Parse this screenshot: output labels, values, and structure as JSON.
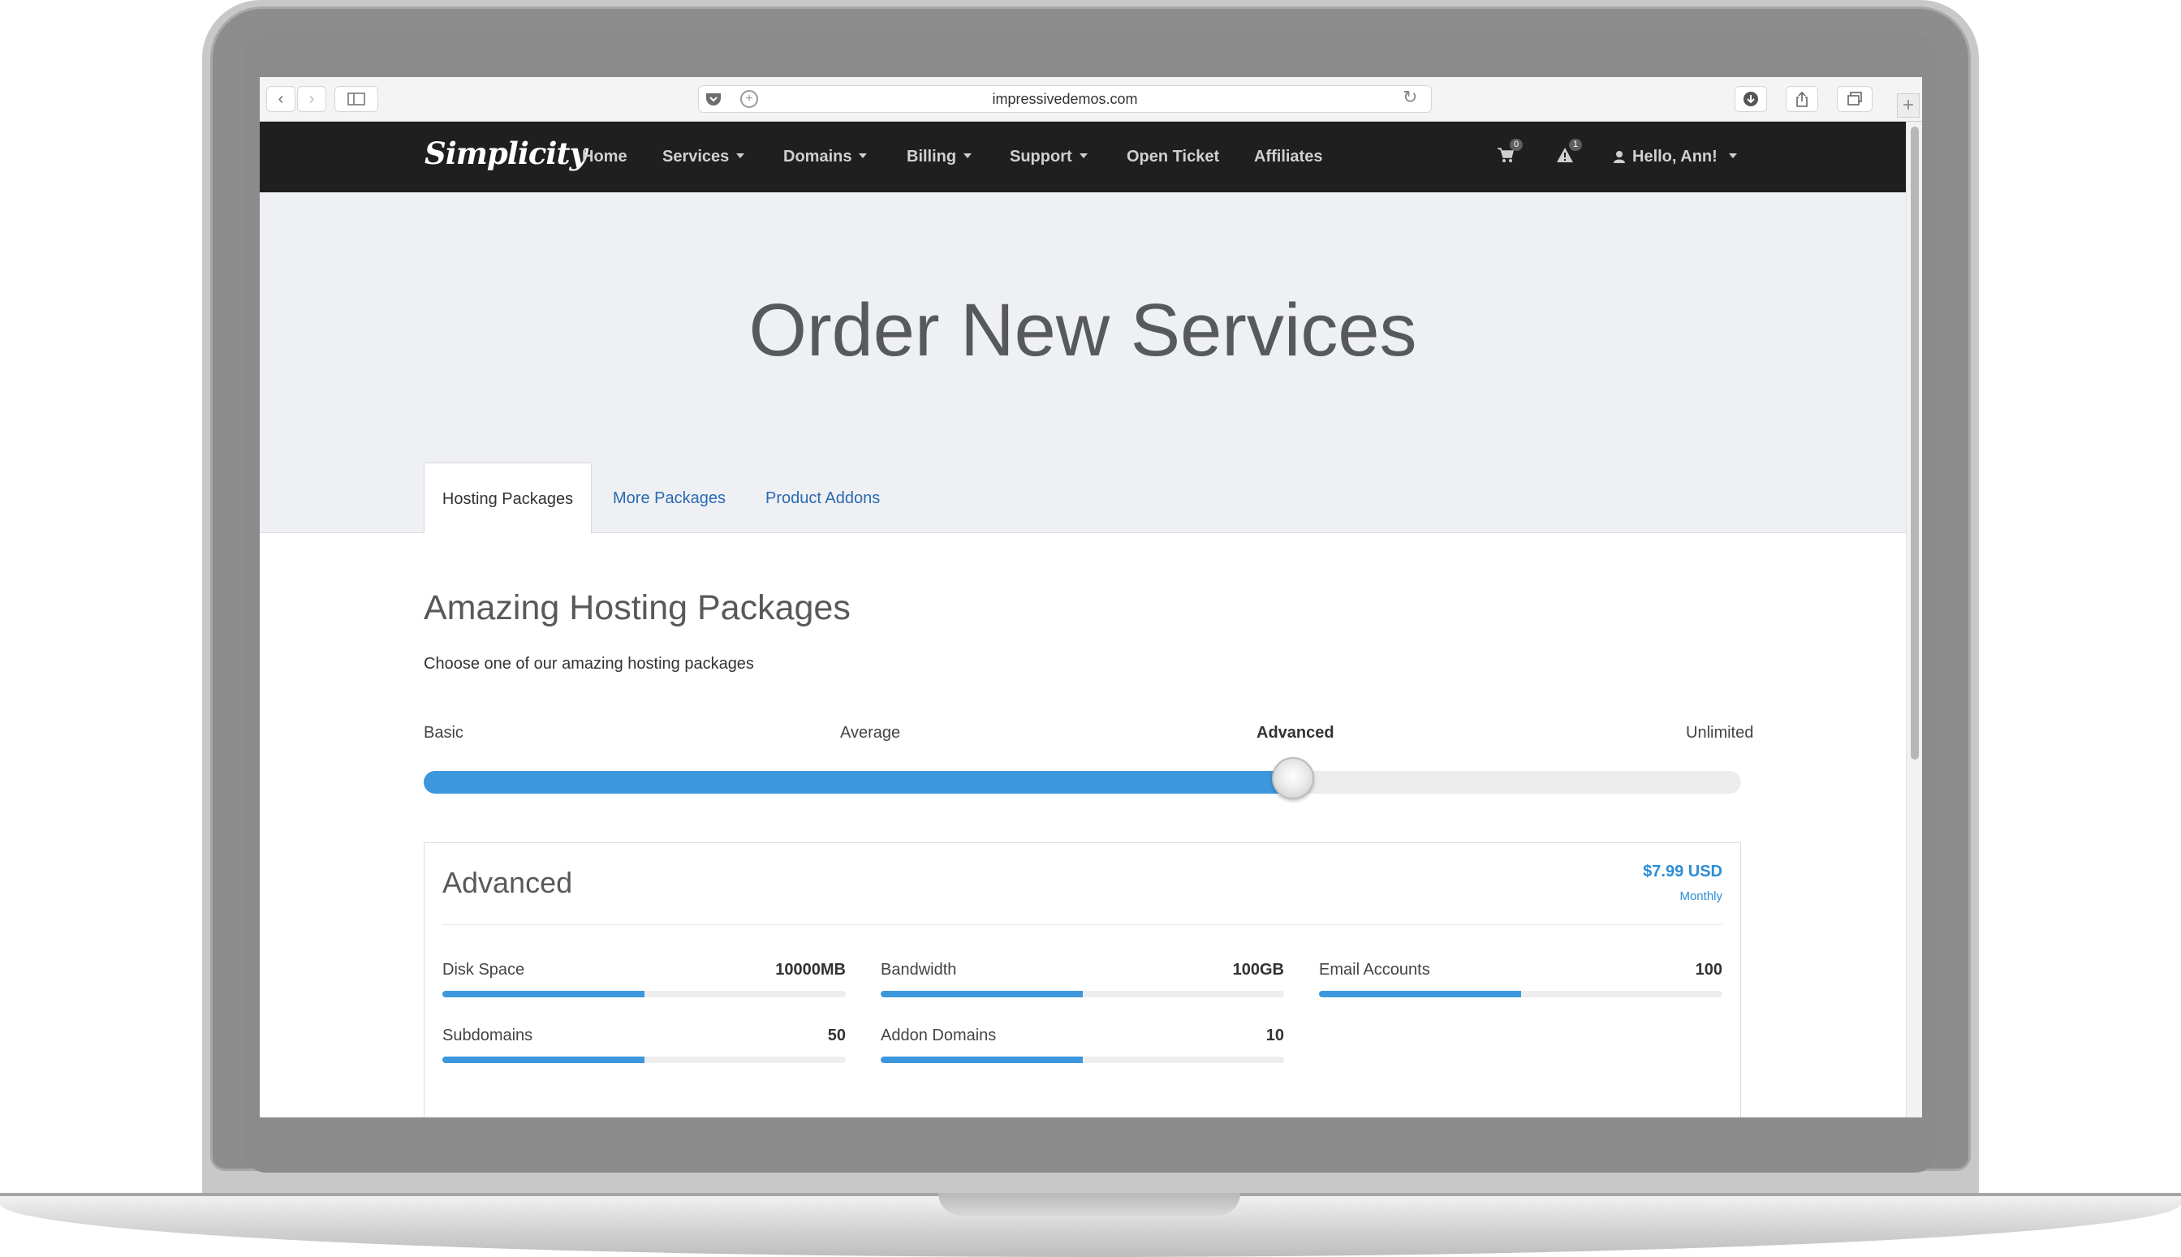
{
  "browser": {
    "url": "impressivedemos.com"
  },
  "navbar": {
    "brand": "Simplicity",
    "items": [
      {
        "label": "Home",
        "dropdown": false
      },
      {
        "label": "Services",
        "dropdown": true
      },
      {
        "label": "Domains",
        "dropdown": true
      },
      {
        "label": "Billing",
        "dropdown": true
      },
      {
        "label": "Support",
        "dropdown": true
      },
      {
        "label": "Open Ticket",
        "dropdown": false
      },
      {
        "label": "Affiliates",
        "dropdown": false
      }
    ],
    "cart_count": "0",
    "alert_count": "1",
    "user_greeting": "Hello, Ann!"
  },
  "hero": {
    "title": "Order New Services"
  },
  "tabs": [
    {
      "label": "Hosting Packages",
      "active": true
    },
    {
      "label": "More Packages",
      "active": false
    },
    {
      "label": "Product Addons",
      "active": false
    }
  ],
  "section": {
    "title": "Amazing Hosting Packages",
    "subtitle": "Choose one of our amazing hosting packages"
  },
  "slider": {
    "stops": [
      "Basic",
      "Average",
      "Advanced",
      "Unlimited"
    ],
    "selected": "Advanced",
    "level_fraction": 0.66
  },
  "package": {
    "name": "Advanced",
    "price": "$7.99 USD",
    "cycle": "Monthly",
    "features": [
      {
        "label": "Disk Space",
        "value": "10000MB",
        "fill_fraction": 0.5
      },
      {
        "label": "Bandwidth",
        "value": "100GB",
        "fill_fraction": 0.5
      },
      {
        "label": "Email Accounts",
        "value": "100",
        "fill_fraction": 0.5
      },
      {
        "label": "Subdomains",
        "value": "50",
        "fill_fraction": 0.5
      },
      {
        "label": "Addon Domains",
        "value": "10",
        "fill_fraction": 0.5
      }
    ]
  },
  "colors": {
    "accent": "#3d97dc",
    "navbar_bg": "#1f1f1f",
    "hero_bg": "#eff0f4",
    "link": "#2a6ab0"
  },
  "icons": {
    "back": "chevron-left-icon",
    "forward": "chevron-right-icon",
    "sidebar": "sidebar-icon",
    "pocket": "pocket-icon",
    "reload": "reload-icon",
    "download": "download-icon",
    "share": "share-icon",
    "tabs": "tabs-icon",
    "cart": "cart-icon",
    "alert": "warning-icon",
    "user": "user-icon"
  }
}
